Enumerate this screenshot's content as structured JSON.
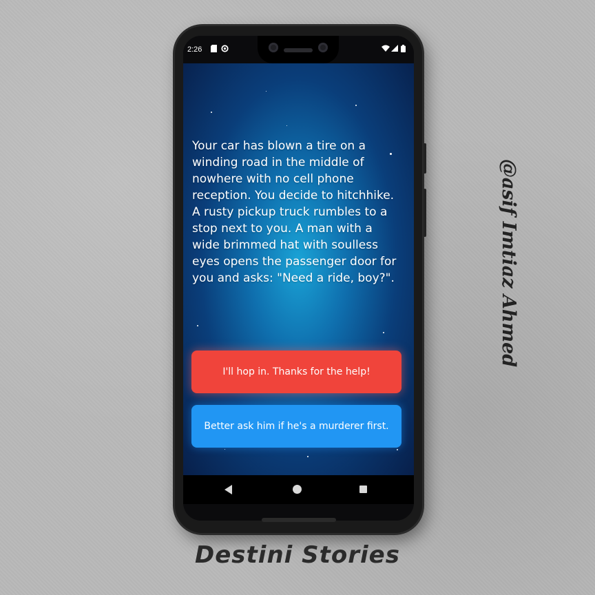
{
  "status_bar": {
    "time": "2:26",
    "left_icons": [
      "sd-card-icon",
      "data-saver-icon"
    ],
    "right_icons": [
      "wifi-icon",
      "signal-icon",
      "battery-icon"
    ]
  },
  "story": {
    "text": "Your car has blown a tire on a winding road in the middle of nowhere with no cell phone reception. You decide to hitchhike. A rusty pickup truck rumbles to a stop next to you. A man with a wide brimmed hat with soulless eyes opens the passenger door for you and asks: \"Need a ride, boy?\"."
  },
  "choices": [
    {
      "label": "I'll hop in. Thanks for the help!",
      "color": "#f0443b"
    },
    {
      "label": "Better ask him if he's a murderer first.",
      "color": "#2196f3"
    }
  ],
  "nav": {
    "icons": [
      "back-icon",
      "home-icon",
      "recent-apps-icon"
    ]
  },
  "caption": {
    "title": "Destini Stories"
  },
  "watermark": {
    "text": "@asif Imtiaz Ahmed"
  }
}
